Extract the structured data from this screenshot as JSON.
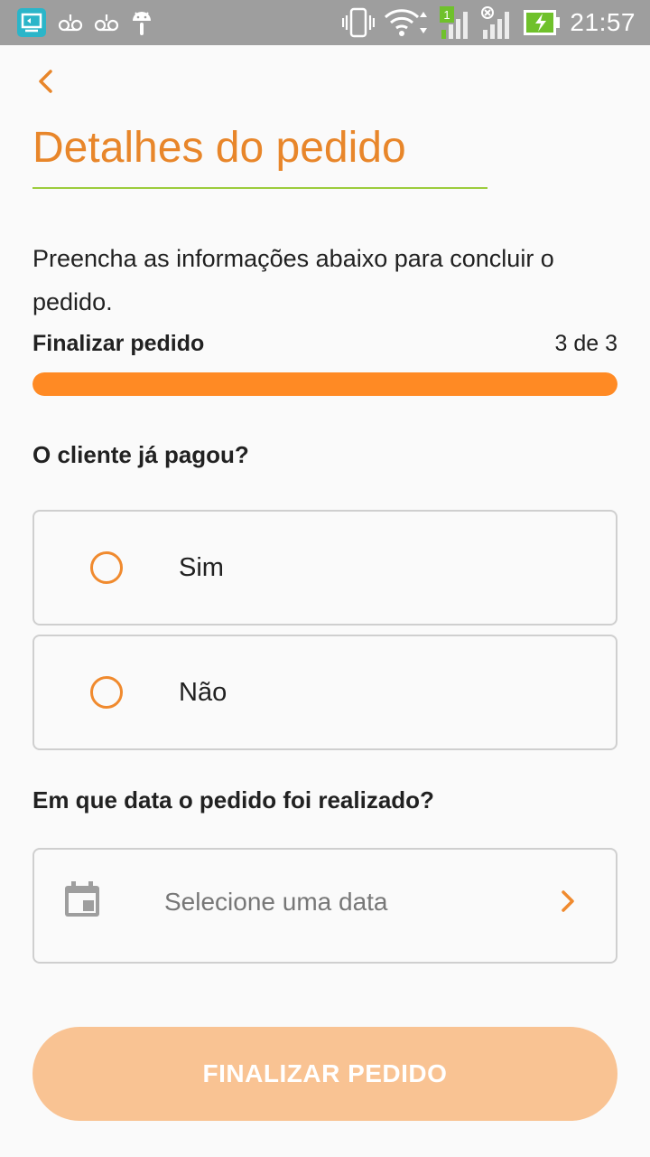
{
  "status_bar": {
    "time": "21:57",
    "icons": [
      "screen-cast-icon",
      "voicemail-icon",
      "voicemail-icon",
      "android-icon",
      "vibrate-icon",
      "wifi-icon",
      "signal-sim1-icon",
      "signal-no-sim-icon",
      "battery-charging-icon"
    ],
    "sim_badge": "1"
  },
  "header": {
    "back_icon": "chevron-left-icon",
    "title": "Detalhes do pedido"
  },
  "intro": "Preencha as informações abaixo para concluir o pedido.",
  "progress": {
    "label": "Finalizar pedido",
    "count": "3 de 3",
    "fraction": 1.0
  },
  "payment": {
    "question": "O cliente já pagou?",
    "options": [
      {
        "label": "Sim",
        "selected": false
      },
      {
        "label": "Não",
        "selected": false
      }
    ]
  },
  "order_date": {
    "question": "Em que data o pedido foi realizado?",
    "placeholder": "Selecione uma data",
    "icon": "calendar-icon",
    "chevron": "chevron-right-icon"
  },
  "finish_button": {
    "label": "FINALIZAR PEDIDO"
  },
  "colors": {
    "accent": "#e8862a",
    "progress": "#ff8a24",
    "underline": "#9ccc3d",
    "button_disabled": "#f9c393",
    "status_bar": "#9e9e9e"
  }
}
